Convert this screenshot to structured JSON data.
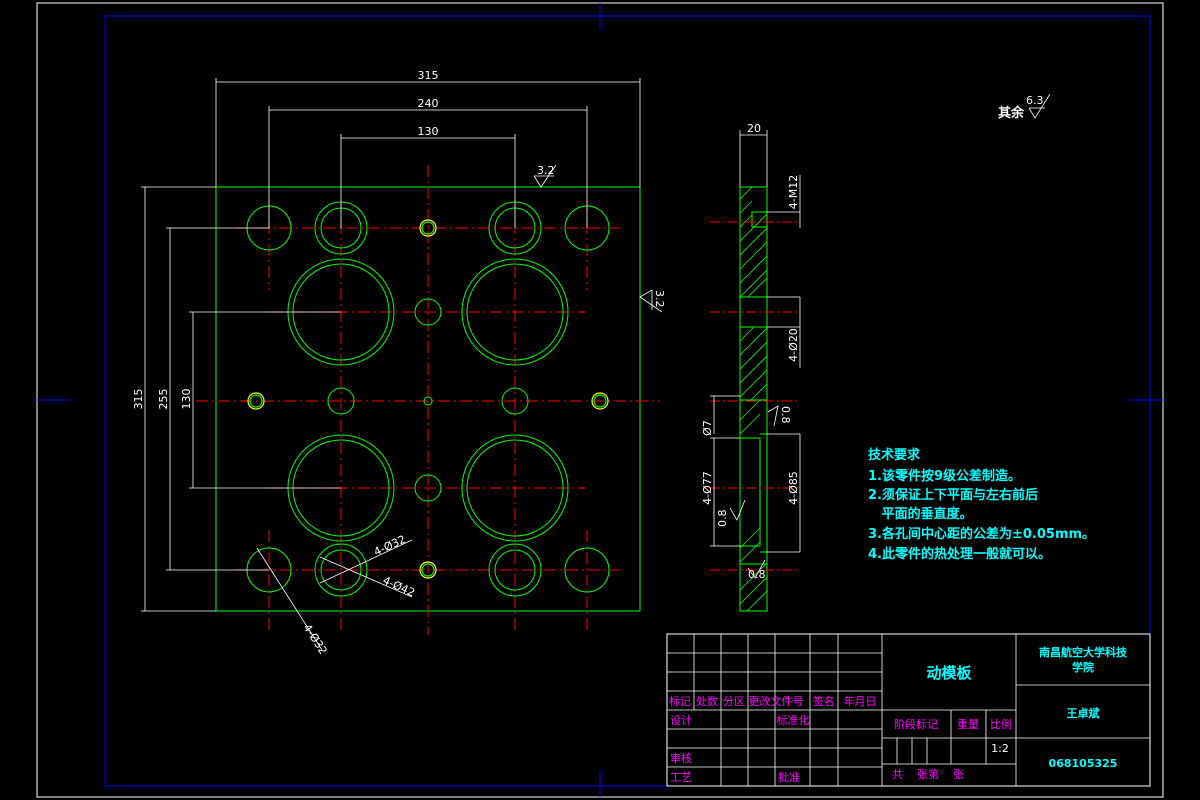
{
  "drawing": {
    "top_view": {
      "dimensions": {
        "width_315": "315",
        "width_240": "240",
        "width_130": "130",
        "height_315": "315",
        "height_255": "255",
        "height_130": "130"
      },
      "roughness_top": "3.2",
      "roughness_right": "3.2",
      "callouts": {
        "d32": "4-Ø32",
        "d42": "4-Ø42",
        "d32b": "4-Ø32"
      }
    },
    "side_view": {
      "thickness": "20",
      "m12": "4-M12",
      "d20": "4-Ø20",
      "d7": "Ø7",
      "d77": "4-Ø77",
      "d85": "4-Ø85",
      "rough_08a": "0.8",
      "rough_08b": "0.8",
      "rough_08c": "0.8"
    },
    "general_roughness": {
      "label": "其余",
      "value": "6.3"
    },
    "tech_requirements": {
      "title": "技术要求",
      "items": [
        "1.该零件按9级公差制造。",
        "2.须保证上下平面与左右前后",
        "   平面的垂直度。",
        "3.各孔间中心距的公差为±0.05mm。",
        "4.此零件的热处理一般就可以。"
      ]
    },
    "title_block": {
      "part_name": "动模板",
      "school": [
        "南昌航空大学科技",
        "学院"
      ],
      "author": "王卓斌",
      "number": "068105325",
      "scale": "1:2",
      "labels": {
        "mark": "标记",
        "count": "处数",
        "zone": "分区",
        "change_doc": "更改文件号",
        "sign": "签名",
        "date": "年月日",
        "design": "设计",
        "standardize": "标准化",
        "stage_mark": "阶段标记",
        "weight": "重量",
        "ratio": "比例",
        "review": "审核",
        "process": "工艺",
        "approve": "批准",
        "sheets": "共    张第    张"
      }
    }
  }
}
